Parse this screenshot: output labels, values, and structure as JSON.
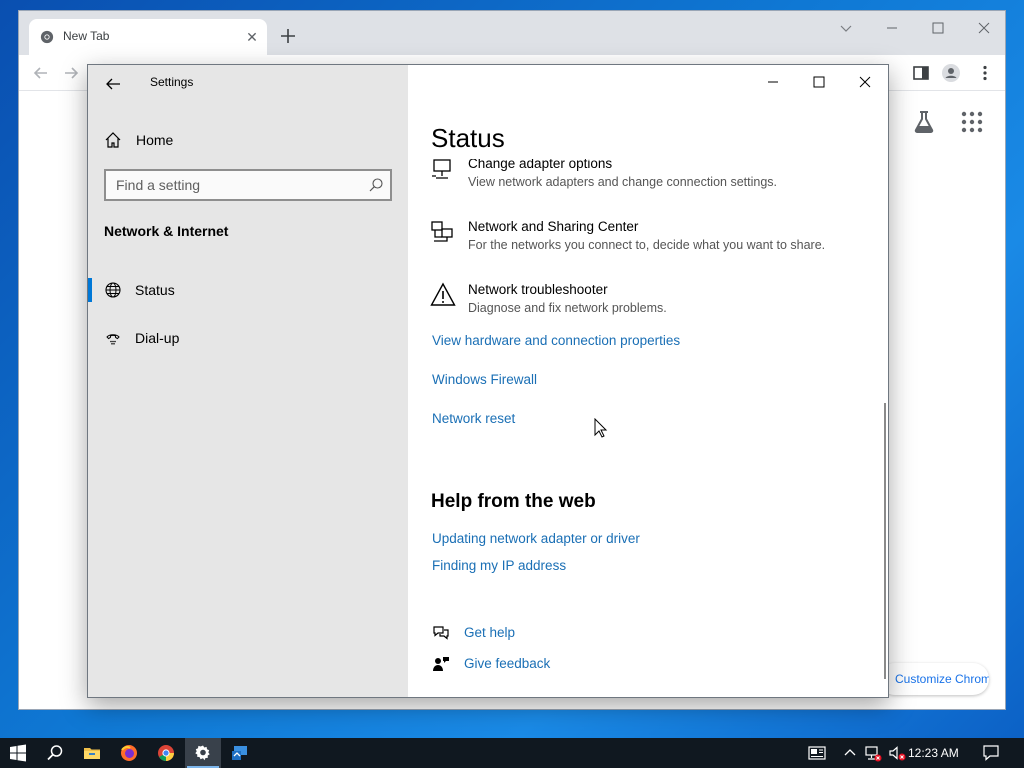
{
  "chrome": {
    "tab_title": "New Tab",
    "customize_label": "Customize Chrome"
  },
  "settings": {
    "window_title": "Settings",
    "sidebar": {
      "home_label": "Home",
      "search_placeholder": "Find a setting",
      "section_title": "Network & Internet",
      "items": [
        {
          "label": "Status",
          "selected": true
        },
        {
          "label": "Dial-up",
          "selected": false
        }
      ]
    },
    "content": {
      "heading": "Status",
      "rows": [
        {
          "title": "Change adapter options",
          "desc": "View network adapters and change connection settings.",
          "icon": "adapter-icon"
        },
        {
          "title": "Network and Sharing Center",
          "desc": "For the networks you connect to, decide what you want to share.",
          "icon": "sharing-center-icon"
        },
        {
          "title": "Network troubleshooter",
          "desc": "Diagnose and fix network problems.",
          "icon": "warning-icon"
        }
      ],
      "links": [
        "View hardware and connection properties",
        "Windows Firewall",
        "Network reset"
      ],
      "help_heading": "Help from the web",
      "help_links": [
        "Updating network adapter or driver",
        "Finding my IP address"
      ],
      "get_help": "Get help",
      "give_feedback": "Give feedback"
    }
  },
  "taskbar": {
    "clock": "12:23 AM"
  },
  "colors": {
    "accent": "#0078d7",
    "link": "#1a6fb5",
    "sidebar_bg": "#e6e6e6",
    "taskbar_bg": "#101820"
  }
}
